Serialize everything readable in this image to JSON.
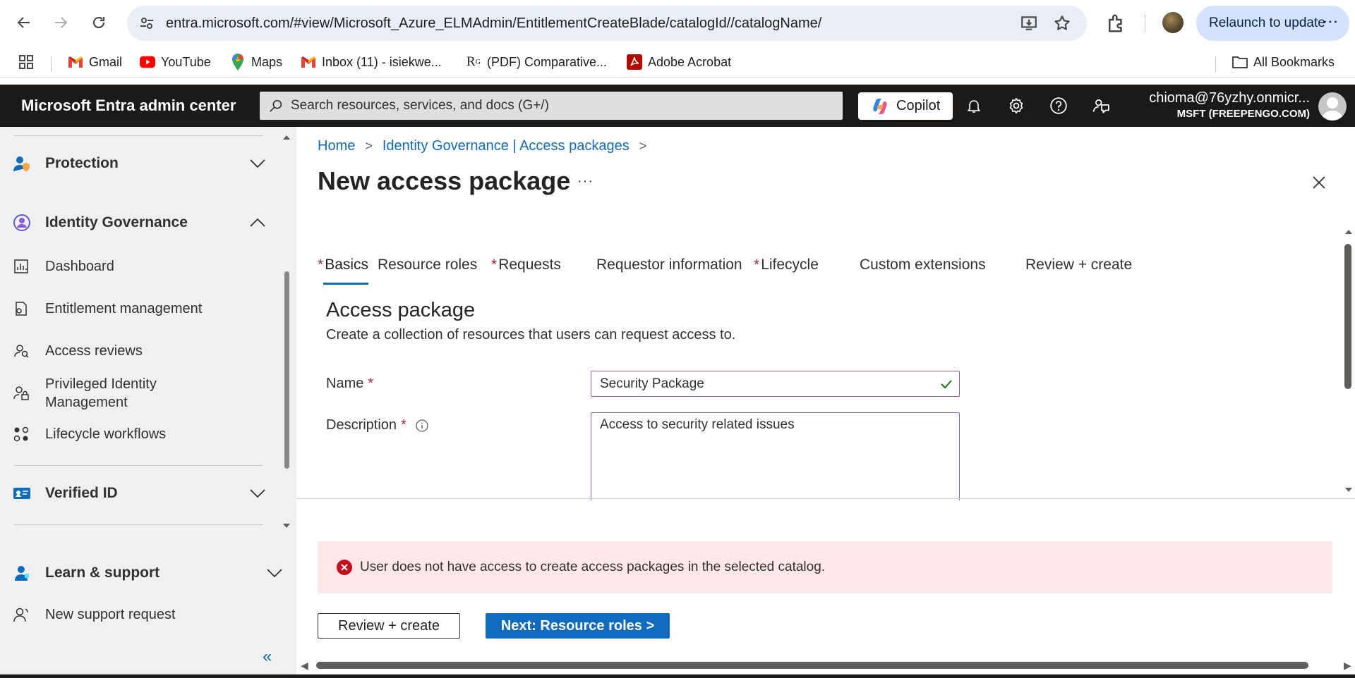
{
  "browser": {
    "url": "entra.microsoft.com/#view/Microsoft_Azure_ELMAdmin/EntitlementCreateBlade/catalogId//catalogName/",
    "relaunch_label": "Relaunch to update",
    "bookmarks": [
      {
        "label": "Gmail",
        "icon": "gmail-icon"
      },
      {
        "label": "YouTube",
        "icon": "youtube-icon"
      },
      {
        "label": "Maps",
        "icon": "maps-icon"
      },
      {
        "label": "Inbox (11) - isiekwe...",
        "icon": "gmail-icon"
      },
      {
        "label": "(PDF) Comparative...",
        "icon": "researchgate-icon"
      },
      {
        "label": "Adobe Acrobat",
        "icon": "acrobat-icon"
      }
    ],
    "all_bookmarks_label": "All Bookmarks"
  },
  "header": {
    "title": "Microsoft Entra admin center",
    "search_placeholder": "Search resources, services, and docs (G+/)",
    "copilot_label": "Copilot",
    "account_email": "chioma@76yzhy.onmicr...",
    "account_tenant": "MSFT (FREEPENGO.COM)"
  },
  "sidebar": {
    "sections": {
      "protection": "Protection",
      "identity_governance": "Identity Governance",
      "verified_id": "Verified ID",
      "learn_support": "Learn & support"
    },
    "items": {
      "dashboard": "Dashboard",
      "entitlement": "Entitlement management",
      "access_reviews": "Access reviews",
      "pim_line1": "Privileged Identity",
      "pim_line2": "Management",
      "lifecycle": "Lifecycle workflows",
      "new_support": "New support request"
    },
    "collapse_glyph": "«"
  },
  "main": {
    "breadcrumb": [
      "Home",
      "Identity Governance | Access packages"
    ],
    "title": "New access package",
    "more_label": "···",
    "tabs": {
      "basics": "Basics",
      "resource_roles": "Resource roles",
      "requests": "Requests",
      "requestor_info": "Requestor information",
      "lifecycle": "Lifecycle",
      "custom_extensions": "Custom extensions",
      "review_create": "Review + create"
    },
    "required_marker": "*",
    "section_heading": "Access package",
    "section_desc": "Create a collection of resources that users can request access to.",
    "name_label": "Name",
    "name_value": "Security Package",
    "description_label": "Description",
    "description_value": "Access to security related issues",
    "error_message": "User does not have access to create access packages in the selected catalog.",
    "review_button": "Review + create",
    "next_button": "Next: Resource roles >"
  },
  "colors": {
    "accent": "#0f6cbd",
    "header_bg": "#1b1a19",
    "error_bg": "#fde7e9",
    "error_icon": "#c50f1f",
    "valid_check": "#107c10",
    "input_border": "#8764b8",
    "required": "#a4262c"
  }
}
